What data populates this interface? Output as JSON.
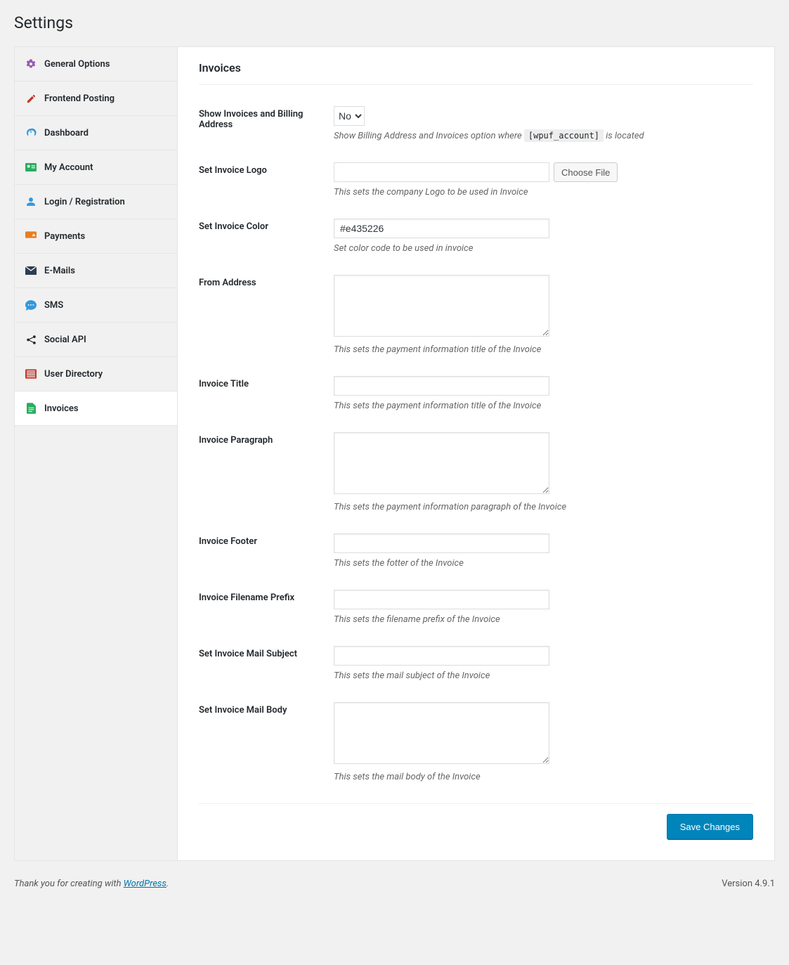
{
  "page_title": "Settings",
  "sidebar": {
    "items": [
      {
        "label": "General Options"
      },
      {
        "label": "Frontend Posting"
      },
      {
        "label": "Dashboard"
      },
      {
        "label": "My Account"
      },
      {
        "label": "Login / Registration"
      },
      {
        "label": "Payments"
      },
      {
        "label": "E-Mails"
      },
      {
        "label": "SMS"
      },
      {
        "label": "Social API"
      },
      {
        "label": "User Directory"
      },
      {
        "label": "Invoices"
      }
    ]
  },
  "main": {
    "title": "Invoices",
    "fields": {
      "show_invoices": {
        "label": "Show Invoices and Billing Address",
        "value": "No",
        "help_pre": "Show Billing Address and Invoices option where ",
        "help_code": "[wpuf_account]",
        "help_post": " is located"
      },
      "logo": {
        "label": "Set Invoice Logo",
        "button": "Choose File",
        "help": "This sets the company Logo to be used in Invoice"
      },
      "color": {
        "label": "Set Invoice Color",
        "value": "#e435226",
        "help": "Set color code to be used in invoice"
      },
      "from_address": {
        "label": "From Address",
        "help": "This sets the payment information title of the Invoice"
      },
      "invoice_title": {
        "label": "Invoice Title",
        "help": "This sets the payment information title of the Invoice"
      },
      "invoice_paragraph": {
        "label": "Invoice Paragraph",
        "help": "This sets the payment information paragraph of the Invoice"
      },
      "invoice_footer": {
        "label": "Invoice Footer",
        "help": "This sets the fotter of the Invoice"
      },
      "filename_prefix": {
        "label": "Invoice Filename Prefix",
        "help": "This sets the filename prefix of the Invoice"
      },
      "mail_subject": {
        "label": "Set Invoice Mail Subject",
        "help": "This sets the mail subject of the Invoice"
      },
      "mail_body": {
        "label": "Set Invoice Mail Body",
        "help": "This sets the mail body of the Invoice"
      }
    },
    "submit_label": "Save Changes"
  },
  "footer": {
    "thank_you_pre": "Thank you for creating with ",
    "thank_you_link": "WordPress",
    "thank_you_post": ".",
    "version": "Version 4.9.1"
  }
}
